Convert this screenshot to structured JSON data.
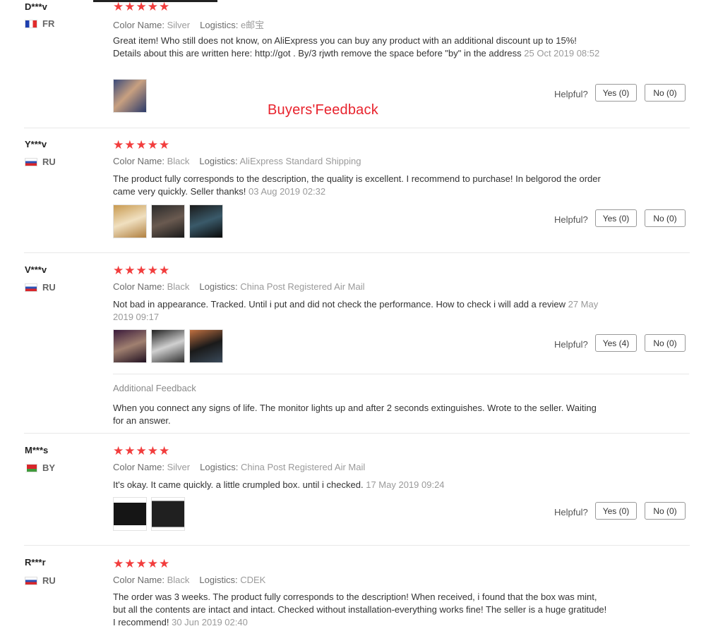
{
  "watermark": "Buyers'Feedback",
  "helpful_label": "Helpful?",
  "reviews": [
    {
      "user": "D***v",
      "country": "FR",
      "stars": "★★★★★",
      "color_key": "Color Name:",
      "color": "Silver",
      "logistics_key": "Logistics:",
      "logistics": "e邮宝",
      "text": "Great item! Who still does not know, on AliExpress you can buy any product with an additional discount up to 15%! Details about this are written here: http://got . By/3 rjwth remove the space before \"by\" in the address",
      "date": "25 Oct 2019 08:52",
      "yes": "Yes (0)",
      "no": "No (0)"
    },
    {
      "user": "Y***v",
      "country": "RU",
      "stars": "★★★★★",
      "color_key": "Color Name:",
      "color": "Black",
      "logistics_key": "Logistics:",
      "logistics": "AliExpress Standard Shipping",
      "text": "The product fully corresponds to the description, the quality is excellent. I recommend to purchase! In belgorod the order came very quickly. Seller thanks!",
      "date": "03 Aug 2019 02:32",
      "yes": "Yes (0)",
      "no": "No (0)"
    },
    {
      "user": "V***v",
      "country": "RU",
      "stars": "★★★★★",
      "color_key": "Color Name:",
      "color": "Black",
      "logistics_key": "Logistics:",
      "logistics": "China Post Registered Air Mail",
      "text": "Not bad in appearance. Tracked. Until i put and did not check the performance. How to check i will add a review",
      "date": "27 May 2019 09:17",
      "yes": "Yes (4)",
      "no": "No (0)",
      "additional_label": "Additional Feedback",
      "additional_text": "When you connect any signs of life. The monitor lights up and after 2 seconds extinguishes. Wrote to the seller. Waiting for an answer."
    },
    {
      "user": "M***s",
      "country": "BY",
      "stars": "★★★★★",
      "color_key": "Color Name:",
      "color": "Silver",
      "logistics_key": "Logistics:",
      "logistics": "China Post Registered Air Mail",
      "text": "It's okay. It came quickly. a little crumpled box. until i checked.",
      "date": "17 May 2019 09:24",
      "yes": "Yes (0)",
      "no": "No (0)"
    },
    {
      "user": "R***r",
      "country": "RU",
      "stars": "★★★★★",
      "color_key": "Color Name:",
      "color": "Black",
      "logistics_key": "Logistics:",
      "logistics": "CDEK",
      "text": "The order was 3 weeks. The product fully corresponds to the description! When received, i found that the box was mint, but all the contents are intact and intact. Checked without installation-everything works fine! The seller is a huge gratitude! I recommend!",
      "date": "30 Jun 2019 02:40"
    }
  ],
  "colors": {
    "star": "#f23d3d",
    "watermark": "#e8232d"
  },
  "icons": [
    "flag-fr-icon",
    "flag-ru-icon",
    "flag-by-icon",
    "star-icon"
  ]
}
